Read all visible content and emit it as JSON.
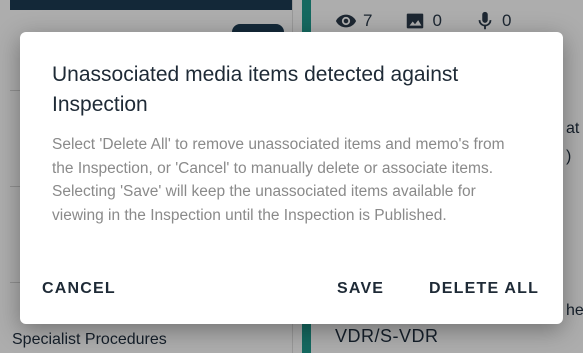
{
  "background": {
    "left_panel": {
      "bottom_text": "Specialist Procedures"
    },
    "right_panel": {
      "counts": [
        {
          "icon": "eye-icon",
          "value": "7"
        },
        {
          "icon": "image-icon",
          "value": "0"
        },
        {
          "icon": "microphone-icon",
          "value": "0"
        }
      ],
      "bottom_text": "VDR/S-VDR",
      "edge_text_1": "at",
      "edge_text_2": ")",
      "edge_text_3": "he"
    },
    "colors": {
      "navy": "#1d3b53",
      "teal": "#1f9b8e"
    }
  },
  "dialog": {
    "title": "Unassociated media items detected against Inspection",
    "body": "Select 'Delete All' to remove unassociated items and memo's from the Inspection, or 'Cancel' to manually delete or associate items. Selecting 'Save' will keep the unassociated items available for viewing in the Inspection until the Inspection is Published.",
    "actions": {
      "cancel": "CANCEL",
      "save": "SAVE",
      "delete_all": "DELETE ALL"
    }
  }
}
